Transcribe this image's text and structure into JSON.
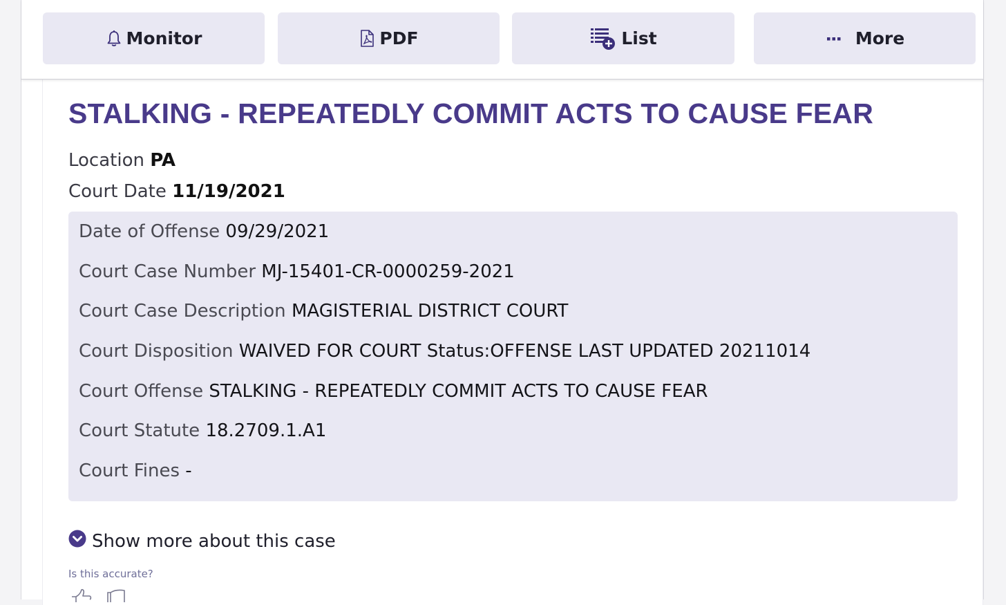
{
  "toolbar": {
    "monitor_label": "Monitor",
    "pdf_label": "PDF",
    "list_label": "List",
    "more_label": "More"
  },
  "case": {
    "title": "STALKING - REPEATEDLY COMMIT ACTS TO CAUSE FEAR",
    "location_label": "Location",
    "location_value": "PA",
    "court_date_label": "Court Date",
    "court_date_value": "11/19/2021"
  },
  "details": [
    {
      "label": "Date of Offense",
      "value": "09/29/2021"
    },
    {
      "label": "Court Case Number",
      "value": "MJ-15401-CR-0000259-2021"
    },
    {
      "label": "Court Case Description",
      "value": "MAGISTERIAL DISTRICT COURT"
    },
    {
      "label": "Court Disposition",
      "value": "WAIVED FOR COURT Status:OFFENSE LAST UPDATED 20211014"
    },
    {
      "label": "Court Offense",
      "value": "STALKING - REPEATEDLY COMMIT ACTS TO CAUSE FEAR"
    },
    {
      "label": "Court Statute",
      "value": "18.2709.1.A1"
    },
    {
      "label": "Court Fines",
      "value": "-"
    }
  ],
  "show_more_label": "Show more about this case",
  "feedback": {
    "prompt": "Is this accurate?"
  },
  "icons": {
    "monitor": "bell-icon",
    "pdf": "pdf-file-icon",
    "list": "list-add-icon",
    "more": "ellipsis-icon",
    "show_more": "chevron-down-circle-icon",
    "thumbs_up": "thumbs-up-icon",
    "thumbs_down": "thumbs-down-icon"
  },
  "colors": {
    "accent": "#493a8a",
    "button_bg": "#e9e8f3",
    "detail_bg": "#e9e8f3"
  }
}
